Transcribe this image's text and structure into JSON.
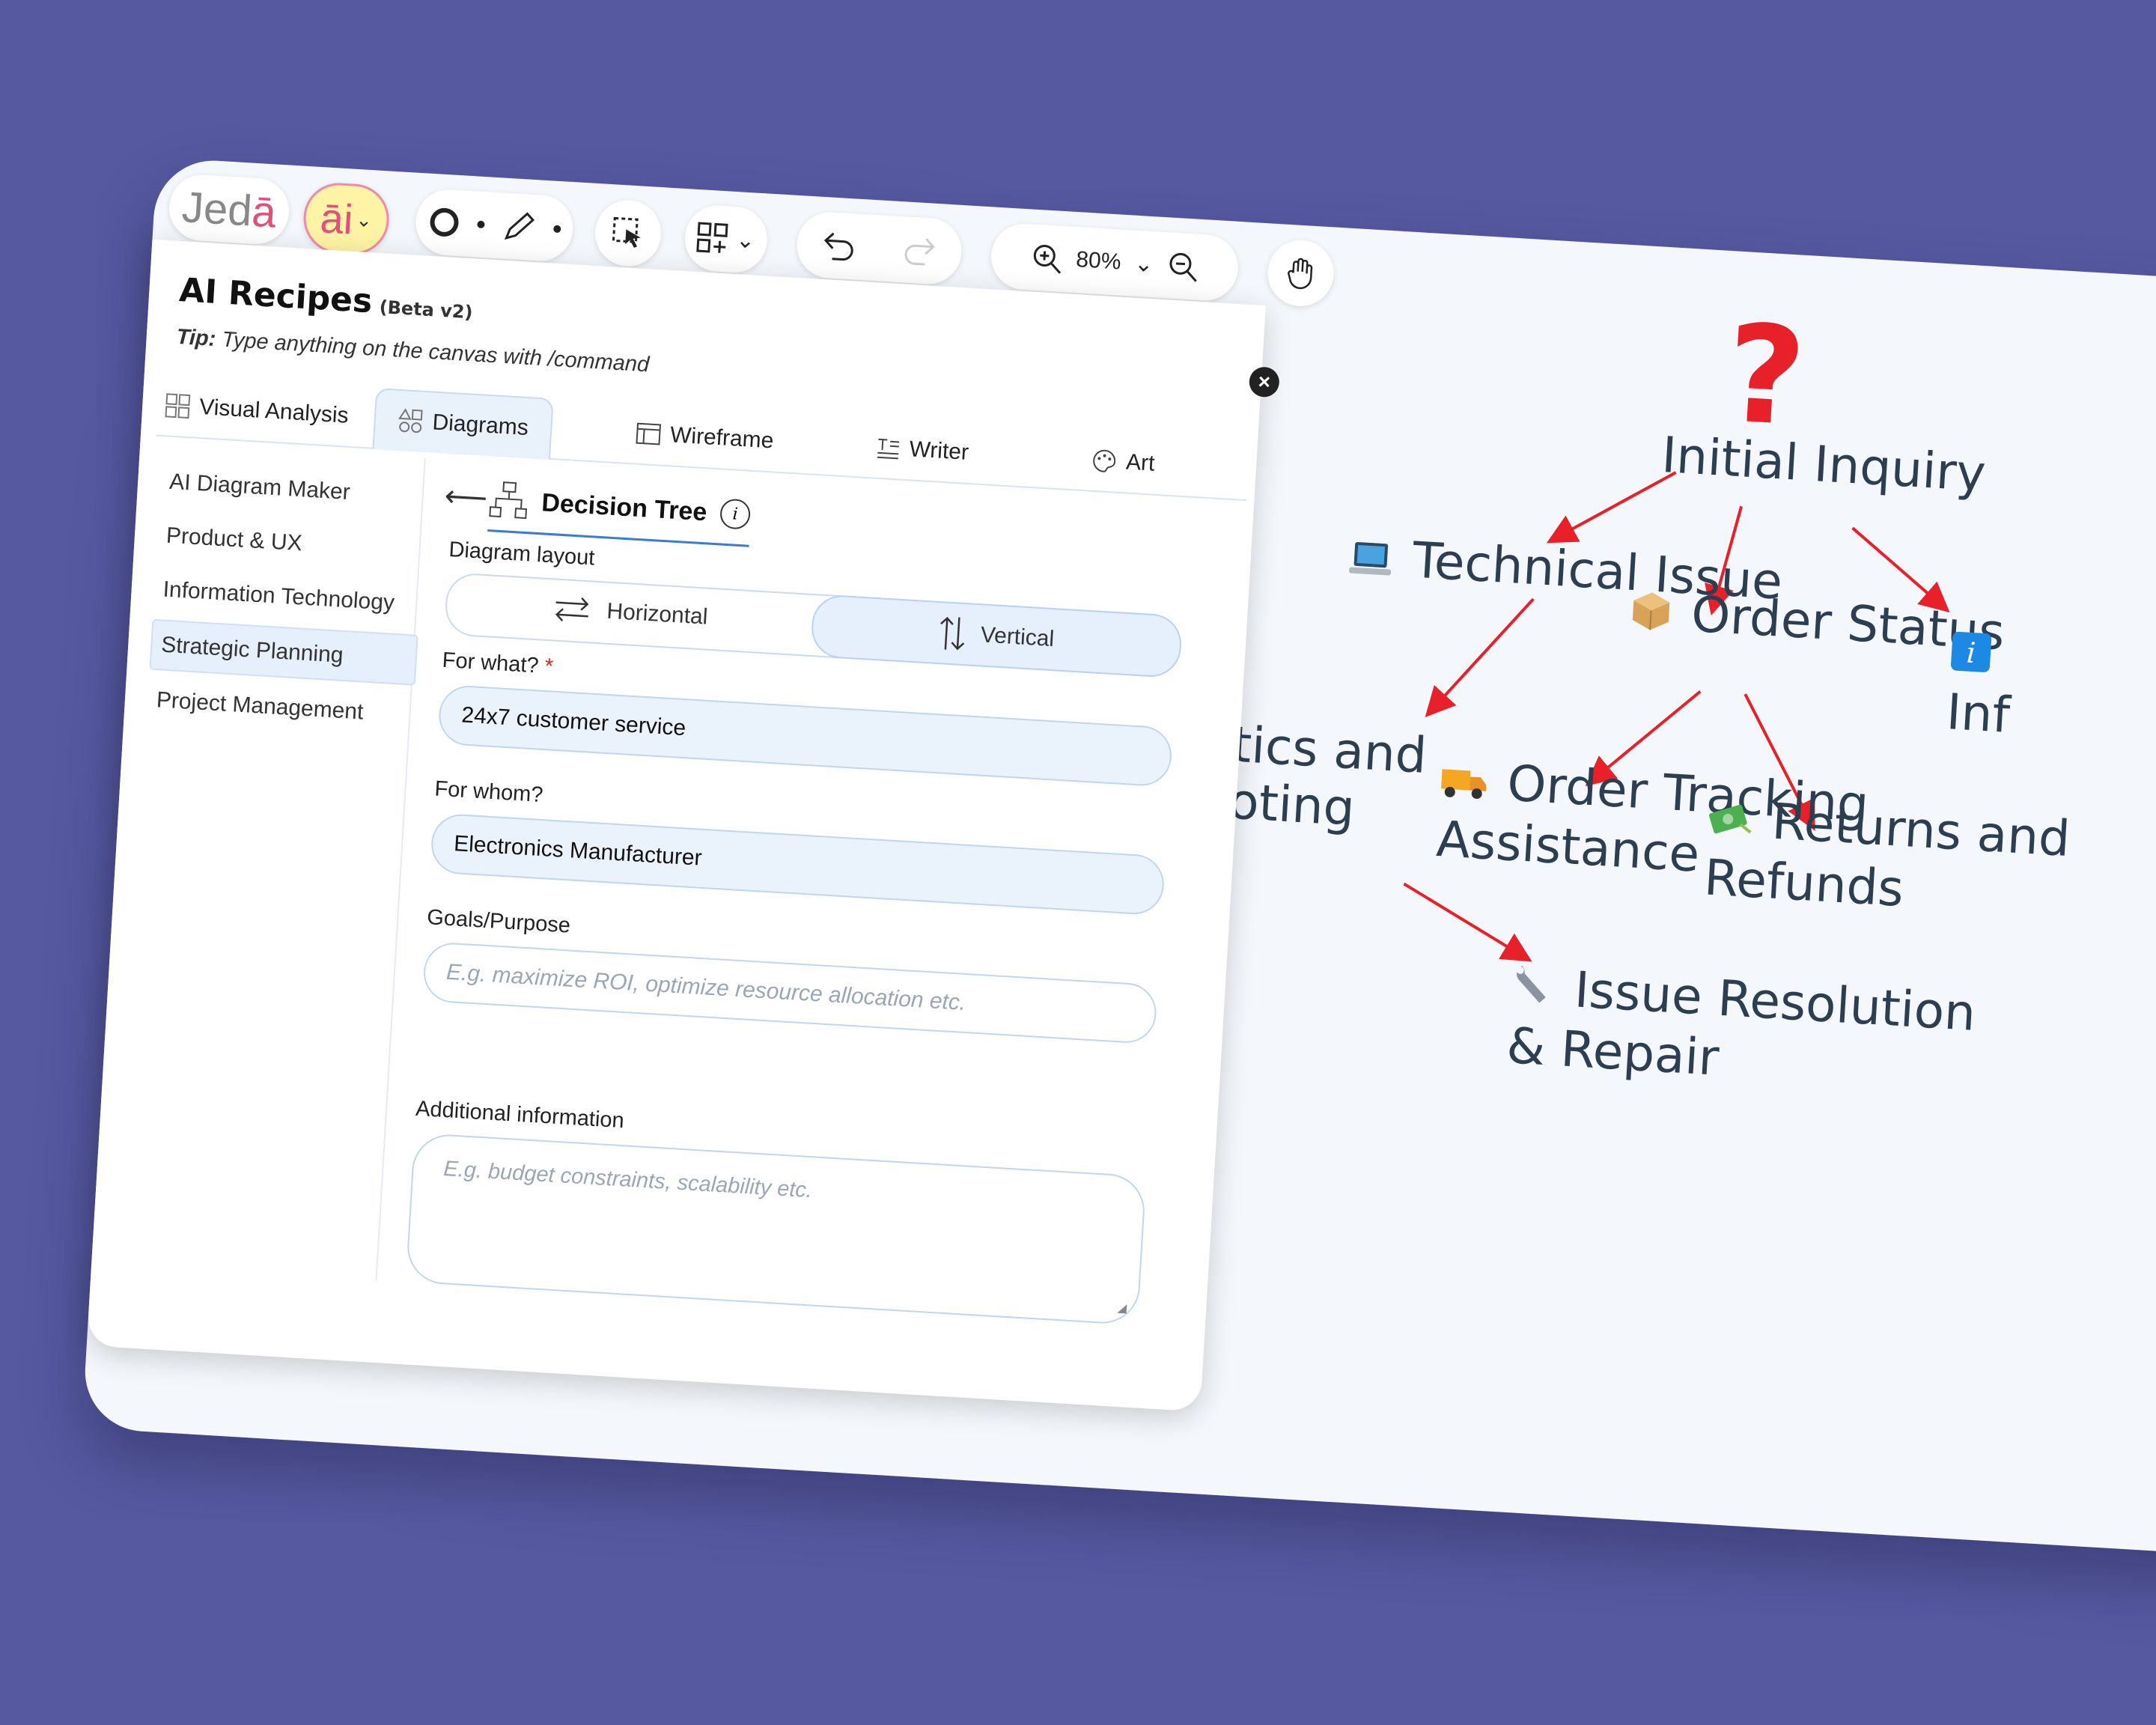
{
  "toolbar": {
    "logo": "Jed",
    "logo_accent": "ā",
    "ai_label": "āi",
    "zoom_level": "80%"
  },
  "panel": {
    "title": "AI Recipes",
    "badge": "(Beta v2)",
    "tip_label": "Tip:",
    "tip_text": "Type anything on the canvas with /command",
    "tabs": [
      "Visual Analysis",
      "Diagrams",
      "Wireframe",
      "Writer",
      "Art"
    ],
    "sidebar": [
      "AI Diagram Maker",
      "Product & UX",
      "Information Technology",
      "Strategic Planning",
      "Project Management"
    ],
    "recipe_title": "Decision Tree",
    "layout_label": "Diagram layout",
    "layout_options": [
      "Horizontal",
      "Vertical"
    ],
    "for_what_label": "For what?",
    "required_mark": "*",
    "for_what_value": "24x7 customer service",
    "for_whom_label": "For whom?",
    "for_whom_value": "Electronics Manufacturer",
    "goals_label": "Goals/Purpose",
    "goals_placeholder": "E.g. maximize ROI, optimize resource allocation etc.",
    "additional_label": "Additional information",
    "additional_placeholder": "E.g. budget constraints, scalability etc."
  },
  "diagram": {
    "root_symbol": "?",
    "root": "Initial Inquiry",
    "technical_issue": "Technical Issue",
    "order_status": "Order Status",
    "info_partial": "Inf",
    "diagnostics_line1": "tics and",
    "diagnostics_line2": "oting",
    "order_tracking_line1": "Order Tracking",
    "order_tracking_line2": "Assistance",
    "returns_line1": "Returns and",
    "returns_line2": "Refunds",
    "resolution_line1": "Issue Resolution",
    "resolution_line2": "& Repair",
    "colors": {
      "arrow": "#e8202a",
      "background": "#5659a0",
      "canvas": "#f4f7fb"
    }
  }
}
